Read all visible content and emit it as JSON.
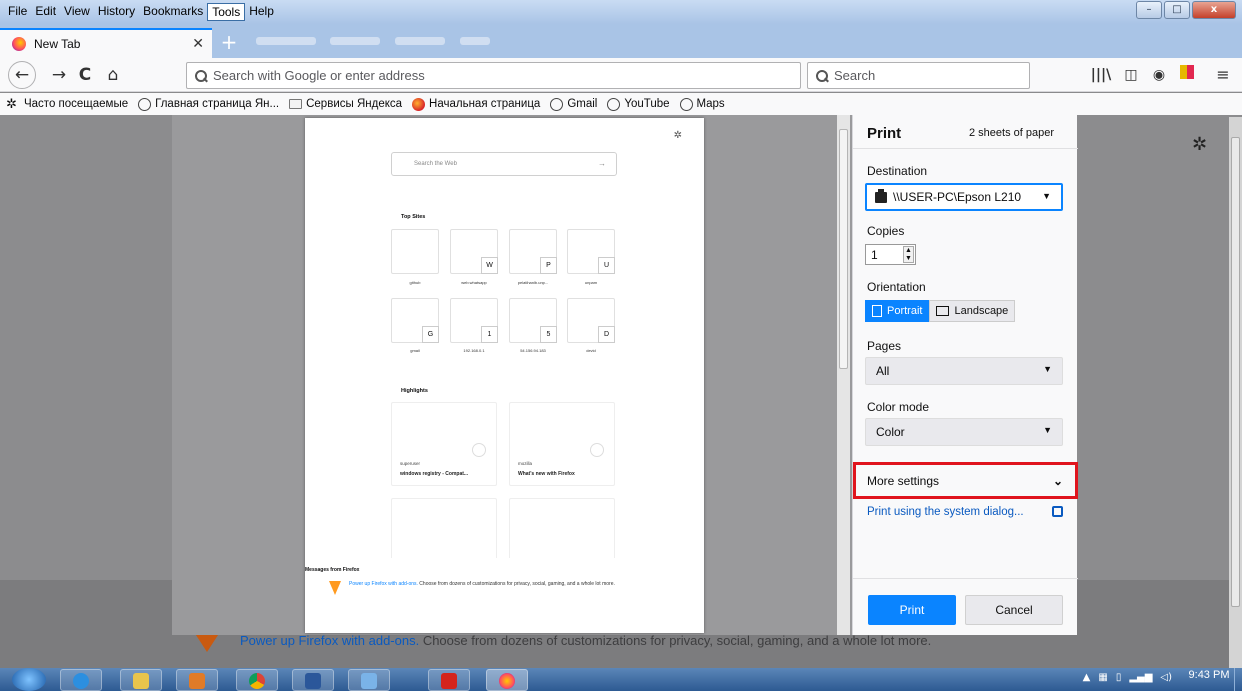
{
  "menubar": {
    "items": [
      "File",
      "Edit",
      "View",
      "History",
      "Bookmarks",
      "Tools",
      "Help"
    ],
    "active": "Tools"
  },
  "window_controls": {
    "minimize": "–",
    "maximize": "□",
    "close": "x"
  },
  "tab": {
    "title": "New Tab",
    "close": "✕",
    "new_tab": "+"
  },
  "navbar": {
    "back": "←",
    "forward": "→",
    "reload": "C",
    "home": "⌂",
    "url_placeholder": "Search with Google or enter address",
    "search_placeholder": "Search",
    "toolbar_icons": [
      "library-icon",
      "sidebar-icon",
      "account-icon",
      "extension-icon",
      "menu-icon"
    ]
  },
  "bookmarks": {
    "items": [
      {
        "label": "Часто посещаемые",
        "icon": "star"
      },
      {
        "label": "Главная страница Ян...",
        "icon": "globe"
      },
      {
        "label": "Сервисы Яндекса",
        "icon": "folder"
      },
      {
        "label": "Начальная страница",
        "icon": "yandex"
      },
      {
        "label": "Gmail",
        "icon": "globe"
      },
      {
        "label": "YouTube",
        "icon": "globe"
      },
      {
        "label": "Maps",
        "icon": "globe"
      }
    ]
  },
  "preview": {
    "search_placeholder": "Search the Web",
    "search_arrow": "→",
    "gear": "✲",
    "top_sites_title": "Top Sites",
    "top_sites": [
      {
        "letter": "",
        "label": "github"
      },
      {
        "letter": "W",
        "label": "web.whatsapp"
      },
      {
        "letter": "P",
        "label": "pelatihanlb.unp..."
      },
      {
        "letter": "U",
        "label": "unpam"
      },
      {
        "letter": "G",
        "label": "gmail"
      },
      {
        "letter": "1",
        "label": "192.168.0.1"
      },
      {
        "letter": "5",
        "label": "54.156.94.183"
      },
      {
        "letter": "D",
        "label": "devid"
      }
    ],
    "highlights_title": "Highlights",
    "highlights": [
      {
        "source": "superuser",
        "title": "windows registry - Compat..."
      },
      {
        "source": "mozilla",
        "title": "What's new with Firefox"
      }
    ],
    "messages_title": "Messages from Firefox",
    "message_link": "Power up Firefox with add-ons.",
    "message_text": " Choose from dozens of customizations for privacy, social, gaming, and a whole lot more."
  },
  "background": {
    "message_link": "Power up Firefox with add-ons.",
    "message_text": " Choose from dozens of customizations for privacy, social, gaming, and a whole lot more.",
    "gear": "✲"
  },
  "print": {
    "title": "Print",
    "sheets": "2 sheets of paper",
    "destination_label": "Destination",
    "destination_value": "\\\\USER-PC\\Epson L210",
    "copies_label": "Copies",
    "copies_value": "1",
    "orientation_label": "Orientation",
    "portrait": "Portrait",
    "landscape": "Landscape",
    "pages_label": "Pages",
    "pages_value": "All",
    "color_label": "Color mode",
    "color_value": "Color",
    "more_settings": "More settings",
    "system_dialog": "Print using the system dialog...",
    "print_button": "Print",
    "cancel_button": "Cancel",
    "highlight_color": "#e0141d",
    "accent_color": "#0a84ff"
  },
  "taskbar": {
    "apps": [
      "ie-icon",
      "explorer-icon",
      "media-icon",
      "chrome-icon",
      "word-icon",
      "paint-icon",
      "acrobat-icon",
      "firefox-icon"
    ],
    "time": "9:43 PM"
  }
}
